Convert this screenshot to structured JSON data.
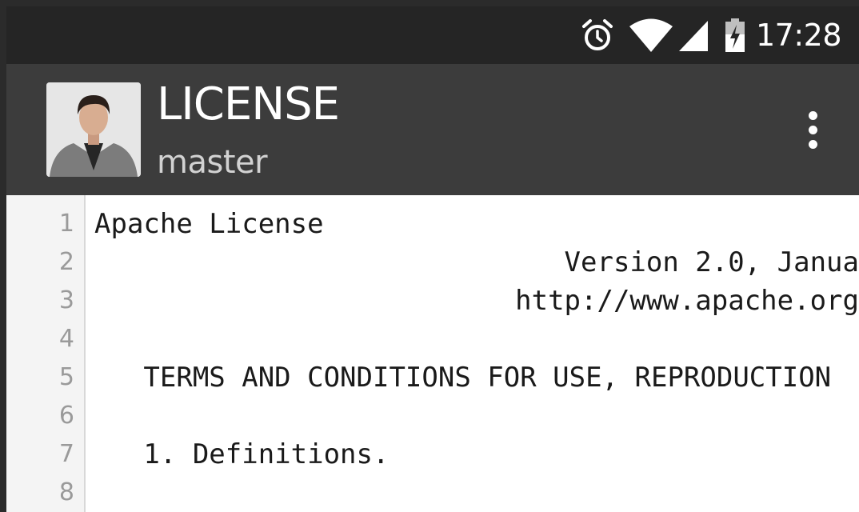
{
  "status_bar": {
    "time": "17:28",
    "icons": [
      "alarm-clock-icon",
      "wifi-icon",
      "cellular-signal-icon",
      "battery-charging-icon"
    ]
  },
  "toolbar": {
    "title": "LICENSE",
    "subtitle": "master",
    "avatar": "user-avatar",
    "menu_icon": "overflow-menu-icon"
  },
  "code": {
    "lines": [
      {
        "number": "1",
        "text": "Apache License"
      },
      {
        "number": "2",
        "text": "Version 2.0, Janua"
      },
      {
        "number": "3",
        "text": "http://www.apache.org"
      },
      {
        "number": "4",
        "text": ""
      },
      {
        "number": "5",
        "text": "   TERMS AND CONDITIONS FOR USE, REPRODUCTION"
      },
      {
        "number": "6",
        "text": ""
      },
      {
        "number": "7",
        "text": "   1. Definitions."
      },
      {
        "number": "8",
        "text": ""
      }
    ]
  },
  "colors": {
    "status_bar_bg": "#252525",
    "toolbar_bg": "#3c3c3c",
    "code_bg": "#ffffff",
    "gutter_bg": "#f4f4f4",
    "line_number": "#9a9a9a"
  }
}
